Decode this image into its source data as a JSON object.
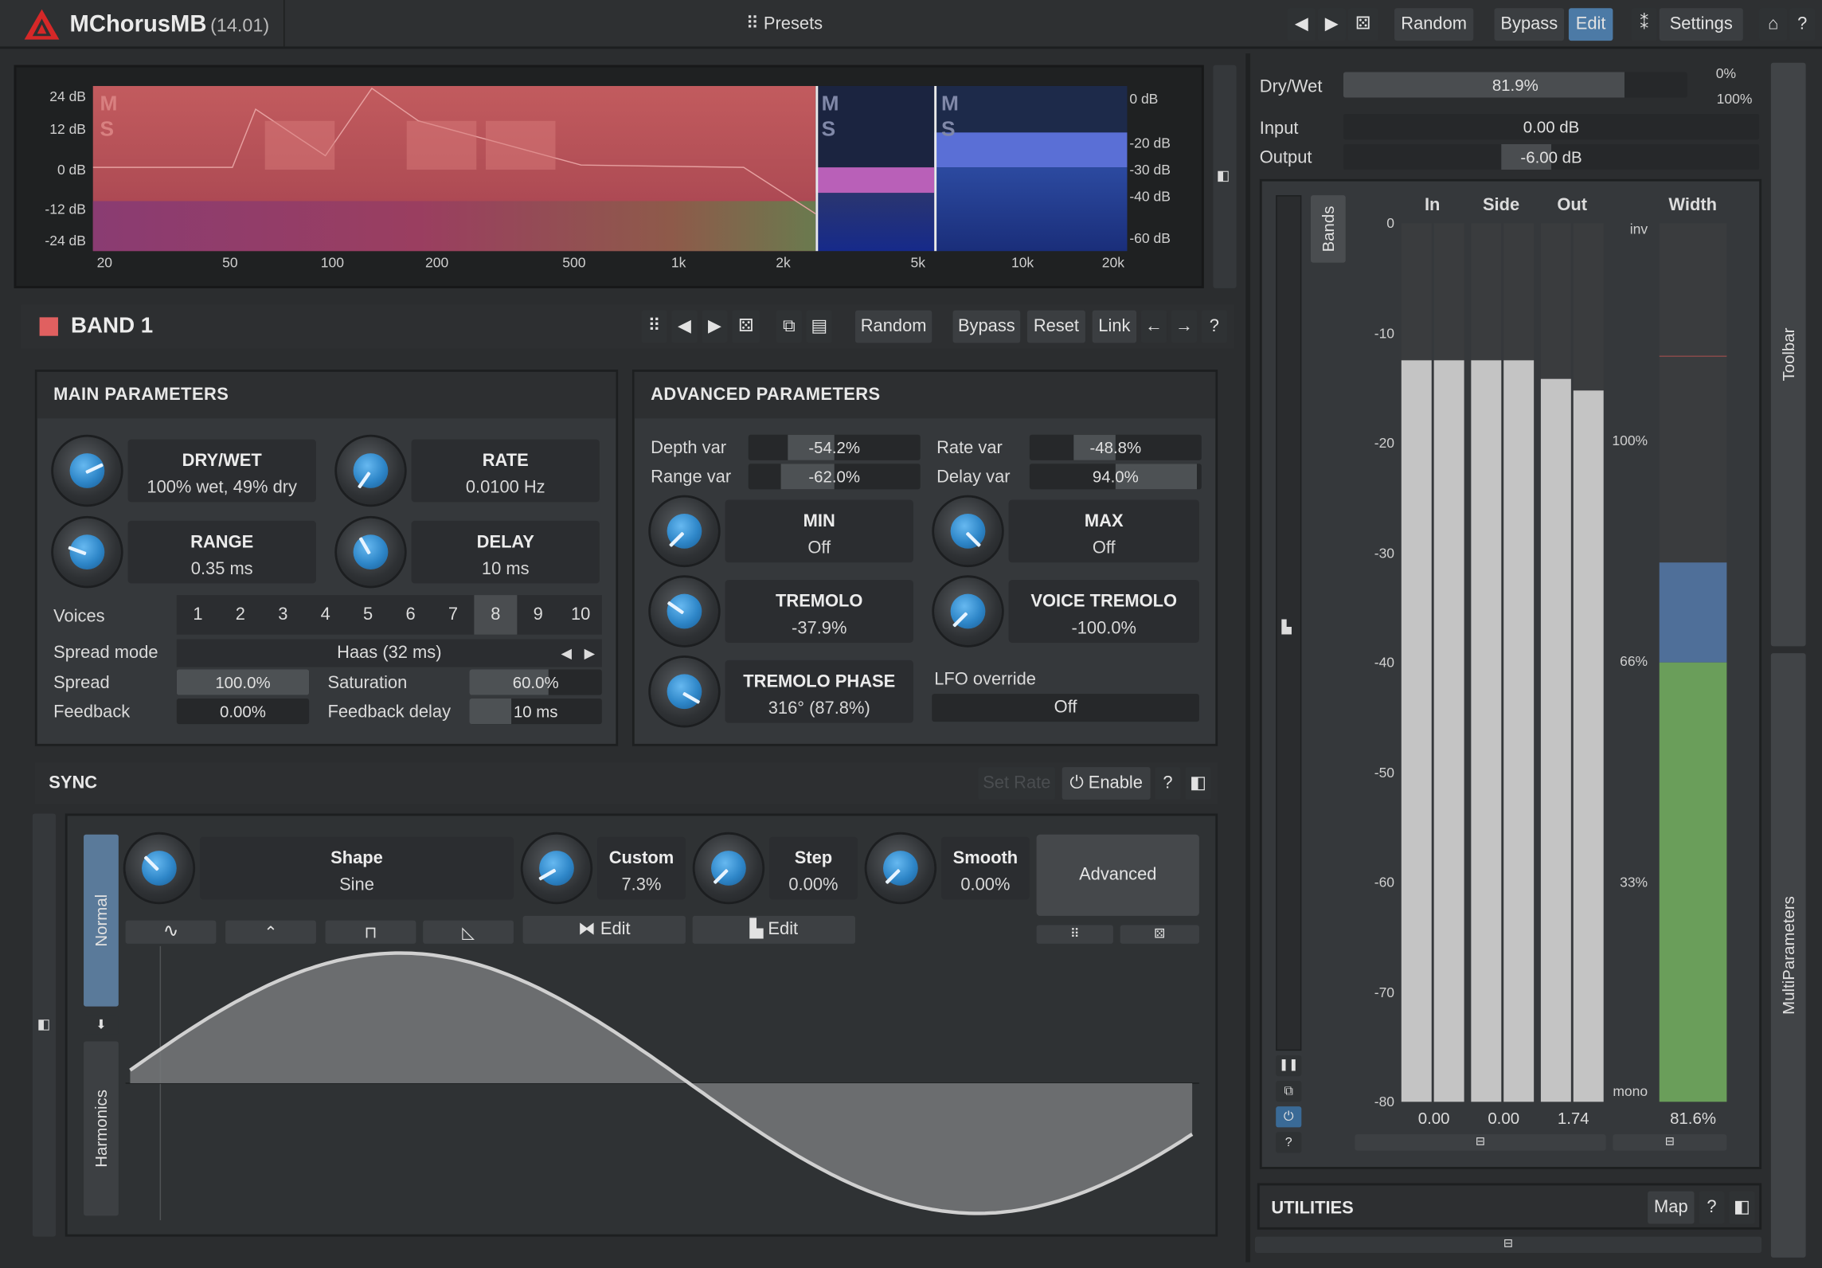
{
  "titlebar": {
    "title": "MChorusMB",
    "version": "(14.01)",
    "presets": "Presets",
    "random": "Random",
    "bypass": "Bypass",
    "edit": "Edit",
    "settings": "Settings"
  },
  "spectrum": {
    "left_scale": [
      "24 dB",
      "12 dB",
      "0 dB",
      "-12 dB",
      "-24 dB"
    ],
    "right_scale": [
      "0 dB",
      "-20 dB",
      "-30 dB",
      "-40 dB",
      "-60 dB"
    ],
    "freq_labels": [
      "20",
      "50",
      "100",
      "200",
      "500",
      "1k",
      "2k",
      "5k",
      "10k",
      "20k"
    ],
    "band_ms": [
      "M",
      "S"
    ]
  },
  "band": {
    "title": "BAND 1",
    "color": "#e06060",
    "random": "Random",
    "bypass": "Bypass",
    "reset": "Reset",
    "link": "Link",
    "help": "?"
  },
  "main_params": {
    "header": "MAIN PARAMETERS",
    "drywet": {
      "label": "DRY/WET",
      "value": "100% wet, 49% dry"
    },
    "rate": {
      "label": "RATE",
      "value": "0.0100 Hz"
    },
    "range": {
      "label": "RANGE",
      "value": "0.35 ms"
    },
    "delay": {
      "label": "DELAY",
      "value": "10 ms"
    },
    "voices_label": "Voices",
    "voices": [
      "1",
      "2",
      "3",
      "4",
      "5",
      "6",
      "7",
      "8",
      "9",
      "10"
    ],
    "voices_selected": "8",
    "spread_mode_label": "Spread mode",
    "spread_mode_value": "Haas (32 ms)",
    "spread_label": "Spread",
    "spread_value": "100.0%",
    "saturation_label": "Saturation",
    "saturation_value": "60.0%",
    "feedback_label": "Feedback",
    "feedback_value": "0.00%",
    "feedback_delay_label": "Feedback delay",
    "feedback_delay_value": "10 ms"
  },
  "adv_params": {
    "header": "ADVANCED PARAMETERS",
    "depth_var_label": "Depth var",
    "depth_var_value": "-54.2%",
    "rate_var_label": "Rate var",
    "rate_var_value": "-48.8%",
    "range_var_label": "Range var",
    "range_var_value": "-62.0%",
    "delay_var_label": "Delay var",
    "delay_var_value": "94.0%",
    "min": {
      "label": "MIN",
      "value": "Off"
    },
    "max": {
      "label": "MAX",
      "value": "Off"
    },
    "tremolo": {
      "label": "TREMOLO",
      "value": "-37.9%"
    },
    "voice_tremolo": {
      "label": "VOICE TREMOLO",
      "value": "-100.0%"
    },
    "tremolo_phase": {
      "label": "TREMOLO PHASE",
      "value": "316° (87.8%)"
    },
    "lfo_override_label": "LFO override",
    "lfo_override_value": "Off"
  },
  "sync": {
    "header": "SYNC",
    "set_rate": "Set Rate",
    "enable": "Enable",
    "help": "?",
    "tab_normal": "Normal",
    "tab_harmonics": "Harmonics",
    "shape": {
      "label": "Shape",
      "value": "Sine"
    },
    "custom": {
      "label": "Custom",
      "value": "7.3%"
    },
    "step": {
      "label": "Step",
      "value": "0.00%"
    },
    "smooth": {
      "label": "Smooth",
      "value": "0.00%"
    },
    "advanced": "Advanced",
    "edit1": "Edit",
    "edit2": "Edit"
  },
  "right": {
    "drywet_label": "Dry/Wet",
    "drywet_value": "81.9%",
    "drywet_fraction": 0.819,
    "drywet_min": "0%",
    "drywet_max": "100%",
    "input_label": "Input",
    "input_value": "0.00 dB",
    "output_label": "Output",
    "output_value": "-6.00 dB",
    "bands_tab": "Bands",
    "toolbar_tab": "Toolbar",
    "multiparams_tab": "MultiParameters",
    "meter_headers": {
      "in": "In",
      "side": "Side",
      "out": "Out",
      "width": "Width"
    },
    "db_scale": [
      "0",
      "-10",
      "-20",
      "-30",
      "-40",
      "-50",
      "-60",
      "-70",
      "-80"
    ],
    "width_scale": [
      "inv",
      "100%",
      "66%",
      "33%",
      "mono"
    ],
    "meter_values": {
      "in": "0.00",
      "side": "0.00",
      "out": "1.74",
      "width": "81.6%"
    },
    "meter_levels_db": {
      "in_l": -12.5,
      "in_r": -12.5,
      "side_l": -12.5,
      "side_r": -12.5,
      "out_l": -14.2,
      "out_r": -15.2
    },
    "utilities": "UTILITIES",
    "map": "Map",
    "help": "?"
  },
  "colors": {
    "accent": "#3a6a96",
    "knob_blue": "#2e86c8",
    "band_red": "#e06060",
    "width_green": "#6a9e5a",
    "width_blue": "#4f6f99"
  }
}
